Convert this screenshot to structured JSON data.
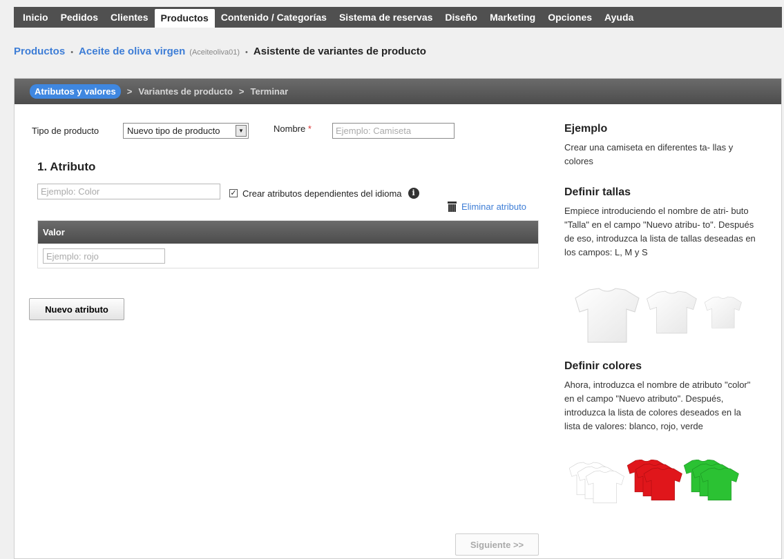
{
  "topnav": {
    "items": [
      {
        "label": "Inicio"
      },
      {
        "label": "Pedidos"
      },
      {
        "label": "Clientes"
      },
      {
        "label": "Productos",
        "active": true
      },
      {
        "label": "Contenido / Categorías"
      },
      {
        "label": "Sistema de reservas"
      },
      {
        "label": "Diseño"
      },
      {
        "label": "Marketing"
      },
      {
        "label": "Opciones"
      },
      {
        "label": "Ayuda"
      }
    ]
  },
  "breadcrumb": {
    "products": "Productos",
    "product": "Aceite de oliva virgen",
    "code": "(Aceiteoliva01)",
    "current": "Asistente de variantes de producto",
    "separator": "•"
  },
  "wizard": {
    "steps": [
      "Atributos y valores",
      "Variantes de producto",
      "Terminar"
    ],
    "separator": ">"
  },
  "form": {
    "product_type_label": "Tipo de producto",
    "product_type_value": "Nuevo tipo de producto",
    "name_label": "Nombre",
    "required_mark": "*",
    "name_placeholder": "Ejemplo: Camiseta",
    "attribute_heading": "1. Atributo",
    "attribute_placeholder": "Ejemplo: Color",
    "lang_checkbox_label": "Crear atributos dependientes del idioma",
    "lang_checkbox_mark": "✓",
    "info_glyph": "i",
    "delete_attribute": "Eliminar atributo",
    "value_header": "Valor",
    "value_placeholder": "Ejemplo: rojo",
    "new_attribute_button": "Nuevo atributo",
    "next_button": "Siguiente >>"
  },
  "help": {
    "example_title": "Ejemplo",
    "example_text": "Crear una camiseta en diferentes ta- llas y colores",
    "sizes_title": "Definir tallas",
    "sizes_text": "Empiece introduciendo el nombre de atri- buto \"Talla\" en el campo \"Nuevo atribu- to\". Después de eso, introduzca la lista de tallas deseadas en los campos: L, M y S",
    "colors_title": "Definir colores",
    "colors_text": "Ahora, introduzca el nombre de atributo \"color\" en el campo \"Nuevo atributo\". Después, introduzca la lista de colores deseados en la lista de valores: blanco, rojo, verde"
  },
  "colors": {
    "nav_bg": "#505050",
    "link": "#3d7dd6",
    "active_step": "#3f87e0",
    "shirt_white": "#ffffff",
    "shirt_red": "#e0161b",
    "shirt_green": "#2bc233"
  }
}
